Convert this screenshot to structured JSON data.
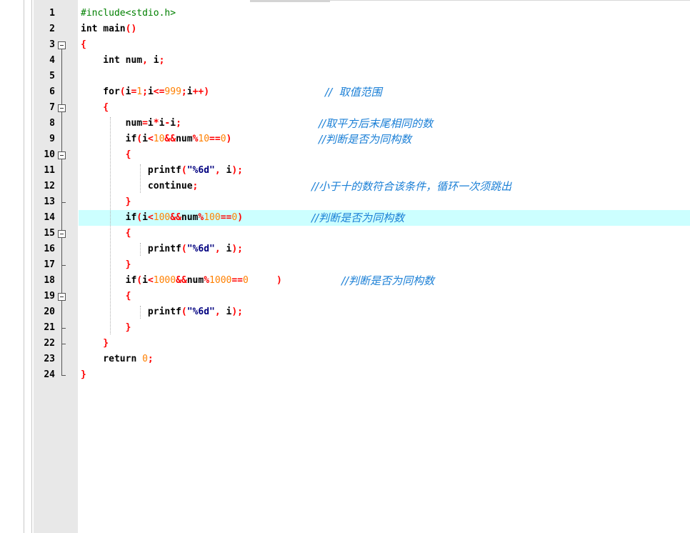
{
  "editor": {
    "language": "C",
    "highlighted_line": 14,
    "lines": [
      {
        "n": "1",
        "tokens": [
          {
            "t": "#include<stdio.h>",
            "c": "pp"
          }
        ]
      },
      {
        "n": "2",
        "tokens": [
          {
            "t": "int main",
            "c": ""
          },
          {
            "t": "()",
            "c": "br"
          }
        ]
      },
      {
        "n": "3",
        "tokens": [
          {
            "t": "{",
            "c": "br"
          }
        ]
      },
      {
        "n": "4",
        "tokens": [
          {
            "t": "    int num",
            "c": ""
          },
          {
            "t": ",",
            "c": "op"
          },
          {
            "t": " i",
            "c": ""
          },
          {
            "t": ";",
            "c": "op"
          }
        ]
      },
      {
        "n": "5",
        "tokens": []
      },
      {
        "n": "6",
        "tokens": [
          {
            "t": "    for",
            "c": ""
          },
          {
            "t": "(",
            "c": "br"
          },
          {
            "t": "i",
            "c": ""
          },
          {
            "t": "=",
            "c": "op"
          },
          {
            "t": "1",
            "c": "num"
          },
          {
            "t": ";",
            "c": "op"
          },
          {
            "t": "i",
            "c": ""
          },
          {
            "t": "<=",
            "c": "op"
          },
          {
            "t": "999",
            "c": "num"
          },
          {
            "t": ";",
            "c": "op"
          },
          {
            "t": "i",
            "c": ""
          },
          {
            "t": "++)",
            "c": "op"
          }
        ],
        "comment": "//  取值范围"
      },
      {
        "n": "7",
        "tokens": [
          {
            "t": "    {",
            "c": "br"
          }
        ]
      },
      {
        "n": "8",
        "tokens": [
          {
            "t": "        num",
            "c": ""
          },
          {
            "t": "=",
            "c": "op"
          },
          {
            "t": "i",
            "c": ""
          },
          {
            "t": "*",
            "c": "op"
          },
          {
            "t": "i",
            "c": ""
          },
          {
            "t": "-",
            "c": "op"
          },
          {
            "t": "i",
            "c": ""
          },
          {
            "t": ";",
            "c": "op"
          }
        ],
        "comment": "//取平方后末尾相同的数"
      },
      {
        "n": "9",
        "tokens": [
          {
            "t": "        if",
            "c": ""
          },
          {
            "t": "(",
            "c": "br"
          },
          {
            "t": "i",
            "c": ""
          },
          {
            "t": "<",
            "c": "op"
          },
          {
            "t": "10",
            "c": "num"
          },
          {
            "t": "&&",
            "c": "op"
          },
          {
            "t": "num",
            "c": ""
          },
          {
            "t": "%",
            "c": "op"
          },
          {
            "t": "10",
            "c": "num"
          },
          {
            "t": "==",
            "c": "op"
          },
          {
            "t": "0",
            "c": "num"
          },
          {
            "t": ")",
            "c": "br"
          }
        ],
        "comment": "//判断是否为同构数"
      },
      {
        "n": "10",
        "tokens": [
          {
            "t": "        {",
            "c": "br"
          }
        ]
      },
      {
        "n": "11",
        "tokens": [
          {
            "t": "            printf",
            "c": ""
          },
          {
            "t": "(",
            "c": "br"
          },
          {
            "t": "\"%6d\"",
            "c": "str"
          },
          {
            "t": ",",
            "c": "op"
          },
          {
            "t": " i",
            "c": ""
          },
          {
            "t": ");",
            "c": "br"
          }
        ]
      },
      {
        "n": "12",
        "tokens": [
          {
            "t": "            continue",
            "c": ""
          },
          {
            "t": ";",
            "c": "op"
          }
        ],
        "comment": "//小于十的数符合该条件，循环一次须跳出"
      },
      {
        "n": "13",
        "tokens": [
          {
            "t": "        }",
            "c": "br"
          }
        ]
      },
      {
        "n": "14",
        "tokens": [
          {
            "t": "        if",
            "c": ""
          },
          {
            "t": "(",
            "c": "br"
          },
          {
            "t": "i",
            "c": ""
          },
          {
            "t": "<",
            "c": "op"
          },
          {
            "t": "100",
            "c": "num"
          },
          {
            "t": "&&",
            "c": "op"
          },
          {
            "t": "num",
            "c": ""
          },
          {
            "t": "%",
            "c": "op"
          },
          {
            "t": "100",
            "c": "num"
          },
          {
            "t": "==",
            "c": "op"
          },
          {
            "t": "0",
            "c": "num"
          },
          {
            "t": ")",
            "c": "br"
          }
        ],
        "comment": "//判断是否为同构数"
      },
      {
        "n": "15",
        "tokens": [
          {
            "t": "        {",
            "c": "br"
          }
        ]
      },
      {
        "n": "16",
        "tokens": [
          {
            "t": "            printf",
            "c": ""
          },
          {
            "t": "(",
            "c": "br"
          },
          {
            "t": "\"%6d\"",
            "c": "str"
          },
          {
            "t": ",",
            "c": "op"
          },
          {
            "t": " i",
            "c": ""
          },
          {
            "t": ");",
            "c": "br"
          }
        ]
      },
      {
        "n": "17",
        "tokens": [
          {
            "t": "        }",
            "c": "br"
          }
        ]
      },
      {
        "n": "18",
        "tokens": [
          {
            "t": "        if",
            "c": ""
          },
          {
            "t": "(",
            "c": "br"
          },
          {
            "t": "i",
            "c": ""
          },
          {
            "t": "<",
            "c": "op"
          },
          {
            "t": "1000",
            "c": "num"
          },
          {
            "t": "&&",
            "c": "op"
          },
          {
            "t": "num",
            "c": ""
          },
          {
            "t": "%",
            "c": "op"
          },
          {
            "t": "1000",
            "c": "num"
          },
          {
            "t": "==",
            "c": "op"
          },
          {
            "t": "0",
            "c": "num"
          },
          {
            "t": "     )",
            "c": "br"
          }
        ],
        "comment": "//判断是否为同构数"
      },
      {
        "n": "19",
        "tokens": [
          {
            "t": "        {",
            "c": "br"
          }
        ]
      },
      {
        "n": "20",
        "tokens": [
          {
            "t": "            printf",
            "c": ""
          },
          {
            "t": "(",
            "c": "br"
          },
          {
            "t": "\"%6d\"",
            "c": "str"
          },
          {
            "t": ",",
            "c": "op"
          },
          {
            "t": " i",
            "c": ""
          },
          {
            "t": ");",
            "c": "br"
          }
        ]
      },
      {
        "n": "21",
        "tokens": [
          {
            "t": "        }",
            "c": "br"
          }
        ]
      },
      {
        "n": "22",
        "tokens": [
          {
            "t": "    }",
            "c": "br"
          }
        ]
      },
      {
        "n": "23",
        "tokens": [
          {
            "t": "    return ",
            "c": ""
          },
          {
            "t": "0",
            "c": "num"
          },
          {
            "t": ";",
            "c": "op"
          }
        ]
      },
      {
        "n": "24",
        "tokens": [
          {
            "t": "}",
            "c": "br"
          }
        ]
      }
    ]
  }
}
